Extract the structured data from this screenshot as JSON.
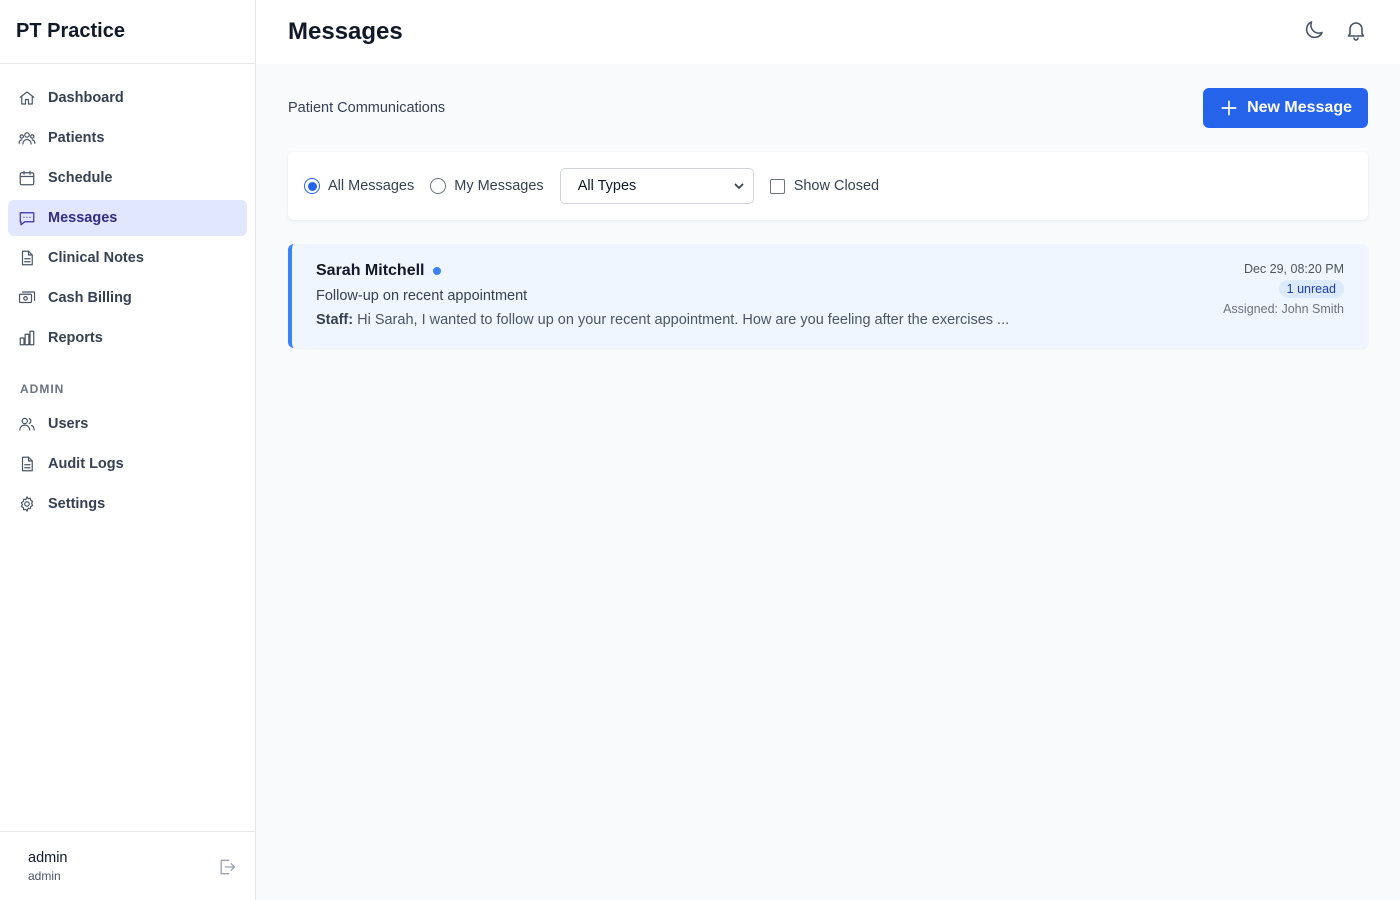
{
  "app": {
    "brand": "PT Practice"
  },
  "sidebar": {
    "items": [
      {
        "label": "Dashboard",
        "icon": "home-icon",
        "active": false
      },
      {
        "label": "Patients",
        "icon": "users-group-icon",
        "active": false
      },
      {
        "label": "Schedule",
        "icon": "calendar-icon",
        "active": false
      },
      {
        "label": "Messages",
        "icon": "chat-bubble-icon",
        "active": true
      },
      {
        "label": "Clinical Notes",
        "icon": "document-icon",
        "active": false
      },
      {
        "label": "Cash Billing",
        "icon": "cash-icon",
        "active": false
      },
      {
        "label": "Reports",
        "icon": "bar-chart-icon",
        "active": false
      }
    ],
    "admin_title": "ADMIN",
    "admin_items": [
      {
        "label": "Users",
        "icon": "users-icon"
      },
      {
        "label": "Audit Logs",
        "icon": "document-icon"
      },
      {
        "label": "Settings",
        "icon": "gear-icon"
      }
    ],
    "footer": {
      "user_name": "admin",
      "user_role": "admin"
    }
  },
  "header": {
    "title": "Messages"
  },
  "main": {
    "subtitle": "Patient Communications",
    "new_button": "New Message",
    "filters": {
      "radio_all": "All Messages",
      "radio_mine": "My Messages",
      "selected_radio": "all",
      "type_select": "All Types",
      "show_closed": "Show Closed",
      "show_closed_checked": false
    },
    "messages": [
      {
        "name": "Sarah Mitchell",
        "subject": "Follow-up on recent appointment",
        "sender": "Staff:",
        "preview": "Hi Sarah, I wanted to follow up on your recent appointment. How are you feeling after the exercises ...",
        "date": "Dec 29, 08:20 PM",
        "unread": "1 unread",
        "assigned": "Assigned: John Smith"
      }
    ]
  },
  "colors": {
    "accent": "#2563eb",
    "active_nav_bg": "#e0e7ff",
    "unread_card_bg": "#eff6ff"
  }
}
